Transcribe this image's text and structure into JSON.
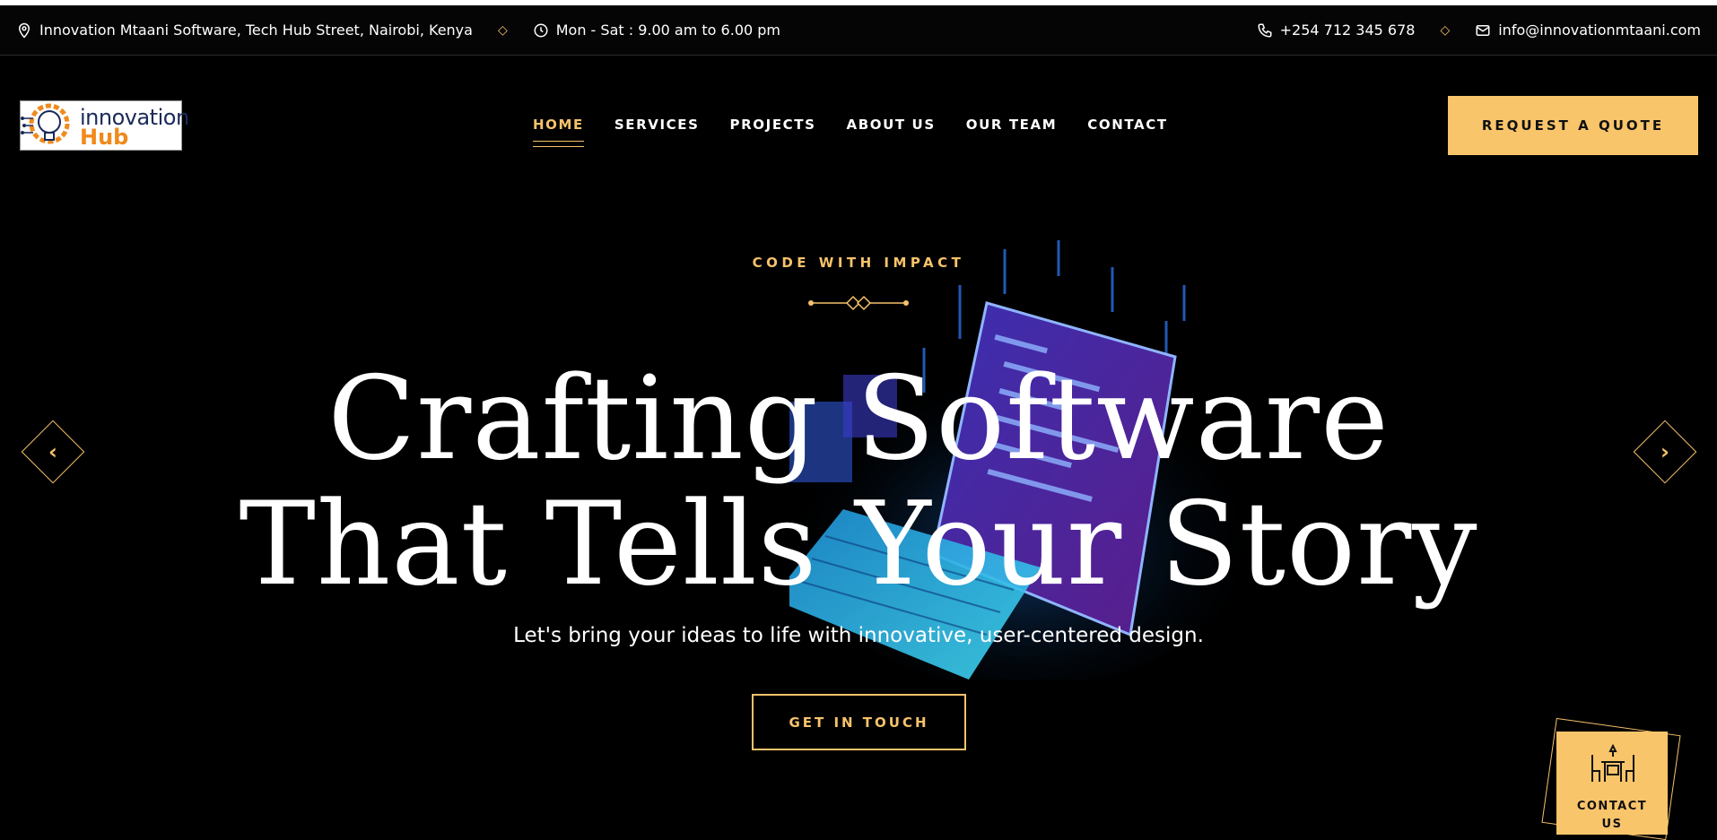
{
  "topbar": {
    "address": "Innovation Mtaani Software, Tech Hub Street, Nairobi, Kenya",
    "hours": "Mon - Sat : 9.00 am to 6.00 pm",
    "phone": "+254 712 345 678",
    "email": "info@innovationmtaani.com",
    "separator": "◇"
  },
  "logo": {
    "line1": "innovation",
    "line2": "Hub"
  },
  "nav": {
    "items": [
      {
        "label": "HOME",
        "active": true
      },
      {
        "label": "SERVICES"
      },
      {
        "label": "PROJECTS"
      },
      {
        "label": "ABOUT US"
      },
      {
        "label": "OUR TEAM"
      },
      {
        "label": "CONTACT"
      }
    ]
  },
  "header": {
    "quote_button": "REQUEST A QUOTE"
  },
  "hero": {
    "eyebrow": "CODE WITH IMPACT",
    "headline_line1": "Crafting Software",
    "headline_line2": "That Tells Your Story",
    "subline": "Let's bring your ideas to life with innovative, user-centered design.",
    "cta": "GET IN TOUCH",
    "prev_icon": "chevron-left-icon",
    "next_icon": "chevron-right-icon"
  },
  "contact_float": {
    "label_line1": "CONTACT",
    "label_line2": "US",
    "icon": "table-chairs-icon"
  },
  "colors": {
    "accent": "#f9c56b",
    "background": "#000000"
  }
}
